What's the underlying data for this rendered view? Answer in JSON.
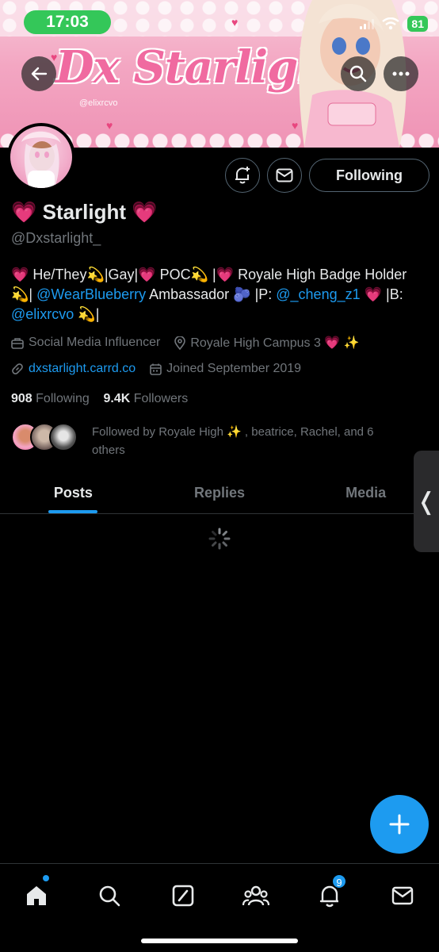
{
  "status_bar": {
    "time": "17:03",
    "battery": "81"
  },
  "banner": {
    "brand_text": "Dx Starlight",
    "credit": "@elixrcvo"
  },
  "profile": {
    "name": "💗 Starlight 💗",
    "handle": "@Dxstarlight_",
    "bio": {
      "line1_part1": "💗 He/They💫|Gay|💗 POC💫 |💗 Royale High Badge Holder",
      "line2_part1": "💫|",
      "mention1": "@WearBlueberry",
      "line2_part2": " Ambassador 🫐 |P: ",
      "mention2": "@_cheng_z1",
      "line2_part3": " 💗 |B:",
      "mention3": "@elixrcvo",
      "line3_part1": " 💫|"
    },
    "category": "Social Media Influencer",
    "location": "Royale High Campus 3 💗 ✨",
    "website": "dxstarlight.carrd.co",
    "joined": "Joined September 2019",
    "following_count": "908",
    "following_label": "Following",
    "followers_count": "9.4K",
    "followers_label": "Followers",
    "followed_by": "Followed by Royale High ✨ , beatrice, Rachel, and 6 others"
  },
  "actions": {
    "following_button": "Following"
  },
  "tabs": [
    {
      "label": "Posts",
      "active": true
    },
    {
      "label": "Replies",
      "active": false
    },
    {
      "label": "Media",
      "active": false
    }
  ],
  "side_handle": "❬",
  "nav": {
    "notifications_badge": "9"
  },
  "colors": {
    "accent": "#1d9bf0",
    "background": "#000000",
    "status_green": "#34c759"
  }
}
